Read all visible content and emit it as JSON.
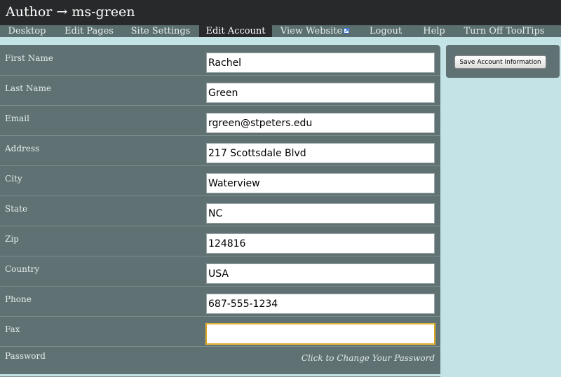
{
  "header": {
    "title": "Author → ms-green"
  },
  "nav": {
    "tabs": [
      {
        "label": "Desktop",
        "active": false
      },
      {
        "label": "Edit Pages",
        "active": false
      },
      {
        "label": "Site Settings",
        "active": false
      },
      {
        "label": "Edit Account",
        "active": true
      },
      {
        "label": "View Website",
        "active": false,
        "icon": "external-link-icon"
      },
      {
        "label": "Logout",
        "active": false
      },
      {
        "label": "Help",
        "active": false
      },
      {
        "label": "Turn Off ToolTips",
        "active": false
      }
    ]
  },
  "form": {
    "fields": [
      {
        "label": "First Name",
        "value": "Rachel"
      },
      {
        "label": "Last Name",
        "value": "Green"
      },
      {
        "label": "Email",
        "value": "rgreen@stpeters.edu"
      },
      {
        "label": "Address",
        "value": "217 Scottsdale Blvd"
      },
      {
        "label": "City",
        "value": "Waterview"
      },
      {
        "label": "State",
        "value": "NC"
      },
      {
        "label": "Zip",
        "value": "124816"
      },
      {
        "label": "Country",
        "value": "USA"
      },
      {
        "label": "Phone",
        "value": "687-555-1234"
      },
      {
        "label": "Fax",
        "value": ""
      }
    ],
    "password": {
      "label": "Password",
      "link_text": "Click to Change Your Password"
    }
  },
  "actions": {
    "save_label": "Save Account Information"
  },
  "colors": {
    "header_bg": "#27292a",
    "nav_bg": "#5b6f70",
    "panel_bg": "#5f7172",
    "page_bg": "#c3e3e6",
    "focus_border": "#d9a31a"
  }
}
